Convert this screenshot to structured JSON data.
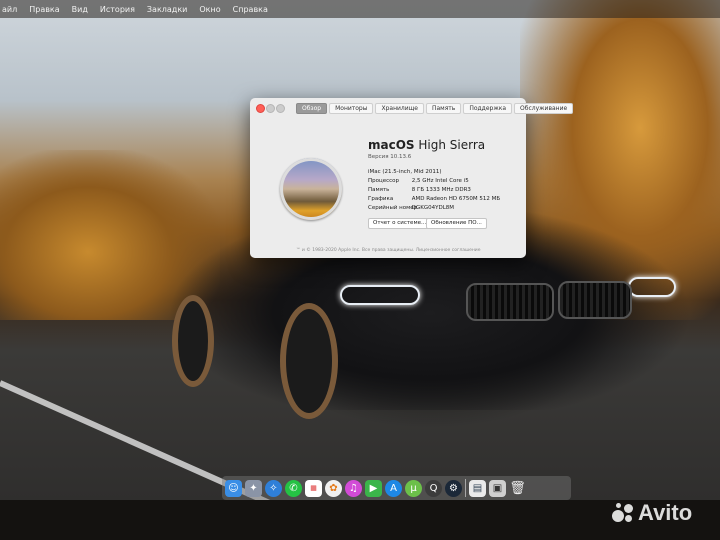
{
  "menubar": {
    "items": [
      "айл",
      "Правка",
      "Вид",
      "История",
      "Закладки",
      "Окно",
      "Справка"
    ]
  },
  "about": {
    "tabs": [
      "Обзор",
      "Мониторы",
      "Хранилище",
      "Память",
      "Поддержка",
      "Обслуживание"
    ],
    "active_tab": "Обзор",
    "os_name_bold": "macOS",
    "os_name": "High Sierra",
    "version": "Версия 10.13.6",
    "model": "iMac (21.5-inch, Mid 2011)",
    "specs": [
      {
        "label": "Процессор",
        "value": "2,5 GHz Intel Core i5"
      },
      {
        "label": "Память",
        "value": "8 ГБ 1333 MHz DDR3"
      },
      {
        "label": "Графика",
        "value": "AMD Radeon HD 6750M 512 МБ"
      },
      {
        "label": "Серийный номер",
        "value": "DGKG04YDL8M"
      }
    ],
    "system_report_button": "Отчет о системе...",
    "software_update_button": "Обновление ПО...",
    "footer": "™ и © 1983-2020 Apple Inc. Все права защищены. Лицензионное соглашение"
  },
  "dock": {
    "icons": [
      "finder-icon",
      "launchpad-icon",
      "safari-icon",
      "whatsapp-icon",
      "calendar-icon",
      "photos-icon",
      "itunes-icon",
      "facetime-icon",
      "app-store-icon",
      "utorrent-icon",
      "quicktime-icon",
      "steam-icon",
      "preview-icon",
      "image-capture-icon",
      "trash-icon"
    ]
  },
  "watermark": "Avito"
}
